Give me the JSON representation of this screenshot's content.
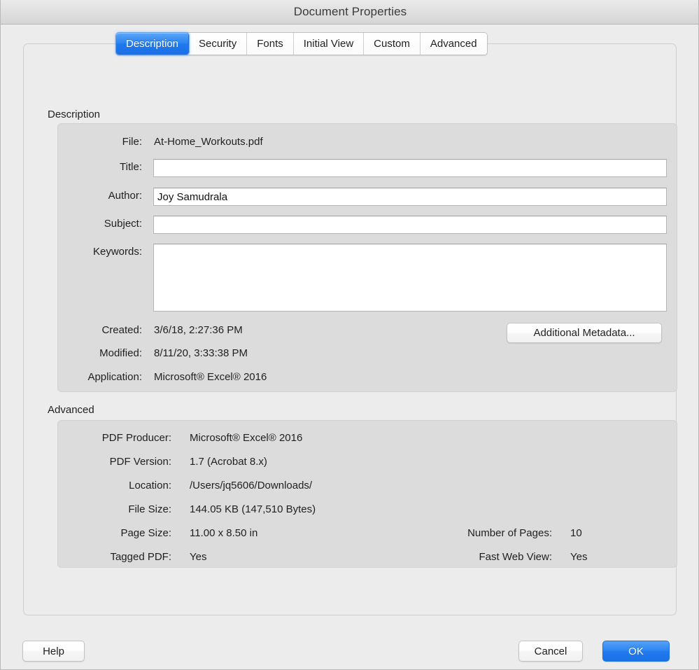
{
  "window": {
    "title": "Document Properties"
  },
  "tabs": [
    {
      "label": "Description",
      "selected": true
    },
    {
      "label": "Security",
      "selected": false
    },
    {
      "label": "Fonts",
      "selected": false
    },
    {
      "label": "Initial View",
      "selected": false
    },
    {
      "label": "Custom",
      "selected": false
    },
    {
      "label": "Advanced",
      "selected": false
    }
  ],
  "description": {
    "group_title": "Description",
    "file": {
      "label": "File:",
      "value": "At-Home_Workouts.pdf"
    },
    "title": {
      "label": "Title:",
      "value": "",
      "placeholder": ""
    },
    "author": {
      "label": "Author:",
      "value": "Joy Samudrala",
      "placeholder": ""
    },
    "subject": {
      "label": "Subject:",
      "value": "",
      "placeholder": ""
    },
    "keywords": {
      "label": "Keywords:",
      "value": "",
      "placeholder": ""
    },
    "created": {
      "label": "Created:",
      "value": "3/6/18, 2:27:36 PM"
    },
    "modified": {
      "label": "Modified:",
      "value": "8/11/20, 3:33:38 PM"
    },
    "application": {
      "label": "Application:",
      "value": "Microsoft® Excel® 2016"
    },
    "additional_metadata_button": "Additional Metadata..."
  },
  "advanced": {
    "group_title": "Advanced",
    "pdf_producer": {
      "label": "PDF Producer:",
      "value": "Microsoft® Excel® 2016"
    },
    "pdf_version": {
      "label": "PDF Version:",
      "value": "1.7 (Acrobat 8.x)"
    },
    "location": {
      "label": "Location:",
      "value": "/Users/jq5606/Downloads/"
    },
    "file_size": {
      "label": "File Size:",
      "value": "144.05 KB (147,510 Bytes)"
    },
    "page_size": {
      "label": "Page Size:",
      "value": "11.00 x 8.50 in"
    },
    "tagged_pdf": {
      "label": "Tagged PDF:",
      "value": "Yes"
    },
    "number_of_pages": {
      "label": "Number of Pages:",
      "value": "10"
    },
    "fast_web_view": {
      "label": "Fast Web View:",
      "value": "Yes"
    }
  },
  "footer": {
    "help": "Help",
    "cancel": "Cancel",
    "ok": "OK"
  },
  "colors": {
    "accent_blue": "#2b82f0",
    "window_background": "#ececec",
    "groupbox_background": "#dcdcdc",
    "titlebar_background": "#dedede",
    "text": "#1f1f1f"
  }
}
